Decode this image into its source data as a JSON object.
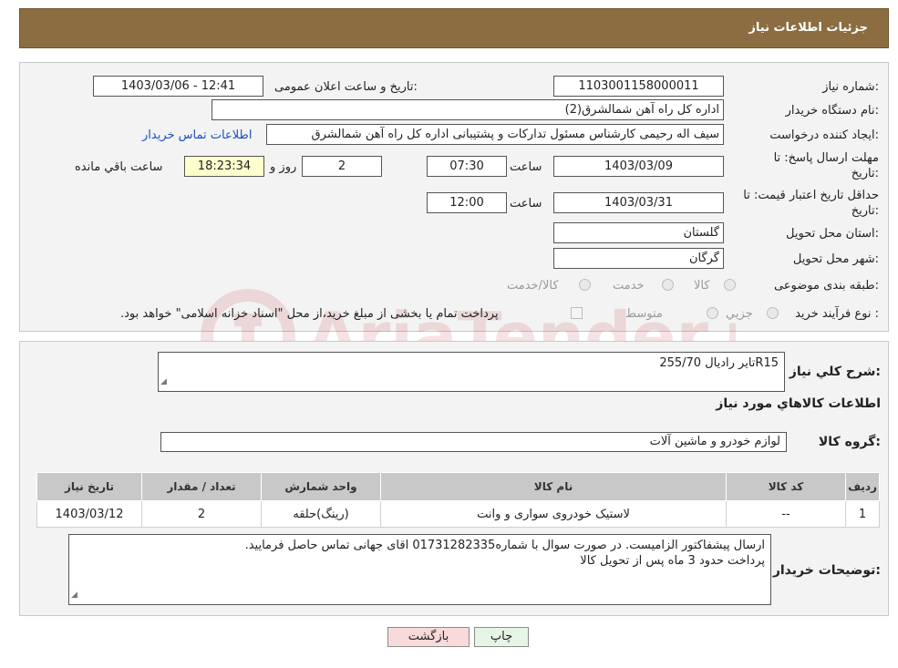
{
  "header": {
    "title": "جزئیات اطلاعات نیاز"
  },
  "form": {
    "need_number_label": "شماره نیاز:",
    "need_number": "1103001158000011",
    "announce_label": "تاریخ و ساعت اعلان عمومی:",
    "announce_value": "1403/03/06 - 12:41",
    "buyer_org_label": "نام دستگاه خریدار:",
    "buyer_org": "اداره کل راه آهن شمالشرق(2)",
    "requester_label": "ایجاد کننده درخواست:",
    "requester": "سیف اله رحیمی کارشناس مسئول تدارکات و پشتیبانی اداره کل راه آهن شمالشرق",
    "contact_link": "اطلاعات تماس خریدار",
    "deadline_label_1": "مهلت ارسال پاسخ: تا",
    "deadline_label_2": "تاریخ:",
    "deadline_date": "1403/03/09",
    "time_word": "ساعت",
    "deadline_time": "07:30",
    "days_value": "2",
    "days_word": "روز و",
    "remaining_time": "18:23:34",
    "remaining_word": "ساعت باقي مانده",
    "validity_label_1": "حداقل تاریخ اعتبار قیمت: تا",
    "validity_label_2": "تاریخ:",
    "validity_date": "1403/03/31",
    "validity_time": "12:00",
    "province_label": "استان محل تحویل:",
    "province": "گلستان",
    "city_label": "شهر محل تحویل:",
    "city": "گرگان",
    "category_label": "طبقه بندی موضوعی:",
    "category_options": [
      "کالا",
      "خدمت",
      "کالا/خدمت"
    ],
    "process_label": "نوع فرآیند خرید :",
    "process_options": [
      "جزیي",
      "متوسط"
    ],
    "process_note": "پرداخت تمام یا بخشی از مبلغ خرید،از محل \"اسناد خزانه اسلامی\" خواهد بود."
  },
  "details": {
    "summary_label": "شرح کلي نياز:",
    "summary": "تایر رادیال 255/70R15",
    "goods_info_title": "اطلاعات کالاهاي مورد نياز",
    "group_label": "گروه کالا:",
    "group": "لوازم خودرو و ماشین آلات",
    "table": {
      "headers": [
        "ردیف",
        "کد کالا",
        "نام کالا",
        "واحد شمارش",
        "تعداد / مقدار",
        "تاریخ نیاز"
      ],
      "rows": [
        [
          "1",
          "--",
          "لاستیک خودروی سواری و وانت",
          "(رینگ)حلقه",
          "2",
          "1403/03/12"
        ]
      ]
    },
    "buyer_notes_label": "توضیحات خریدار:",
    "buyer_notes_line1": "ارسال پیشفاکتور الزامیست. در صورت سوال با شماره01731282335 اقای جهانی تماس حاصل فرمایید.",
    "buyer_notes_line2": "پرداخت حدود 3 ماه پس از تحویل کالا"
  },
  "buttons": {
    "print": "چاپ",
    "back": "بازگشت"
  },
  "watermark_text": "AriaTender.neT",
  "colors": {
    "header": "#8b6d41",
    "link": "#1a4fc4",
    "remaining_bg": "#ffffcc",
    "back_button_bg": "#f9dada",
    "print_button_bg": "#e6f5e6"
  }
}
